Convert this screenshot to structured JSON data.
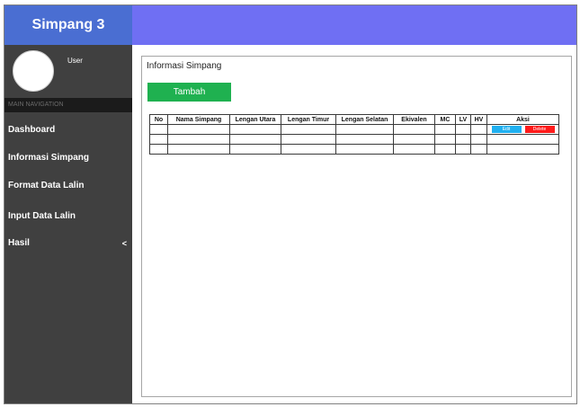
{
  "brand": {
    "title": "Simpang 3"
  },
  "sidebar": {
    "user_label": "User",
    "nav_header": "MAIN NAVIGATION",
    "items": [
      {
        "label": "Dashboard"
      },
      {
        "label": "Informasi Simpang"
      },
      {
        "label": "Format Data Lalin"
      },
      {
        "label": "Input Data Lalin"
      },
      {
        "label": "Hasil",
        "chevron": "<"
      }
    ]
  },
  "main": {
    "title": "Informasi Simpang",
    "add_button": "Tambah",
    "table": {
      "headers": [
        "No",
        "Nama Simpang",
        "Lengan Utara",
        "Lengan Timur",
        "Lengan Selatan",
        "Ekivalen",
        "MC",
        "LV",
        "HV",
        "Aksi"
      ],
      "edit_label": "Edit",
      "delete_label": "Delete",
      "row_count": 3
    }
  },
  "colors": {
    "brand_bg": "#4a6ed2",
    "topbar_bg": "#6f6ff3",
    "sidebar_bg": "#404040",
    "add_button_bg": "#1fb150",
    "edit_button_bg": "#20b0f0",
    "delete_button_bg": "#ff1a1a"
  }
}
